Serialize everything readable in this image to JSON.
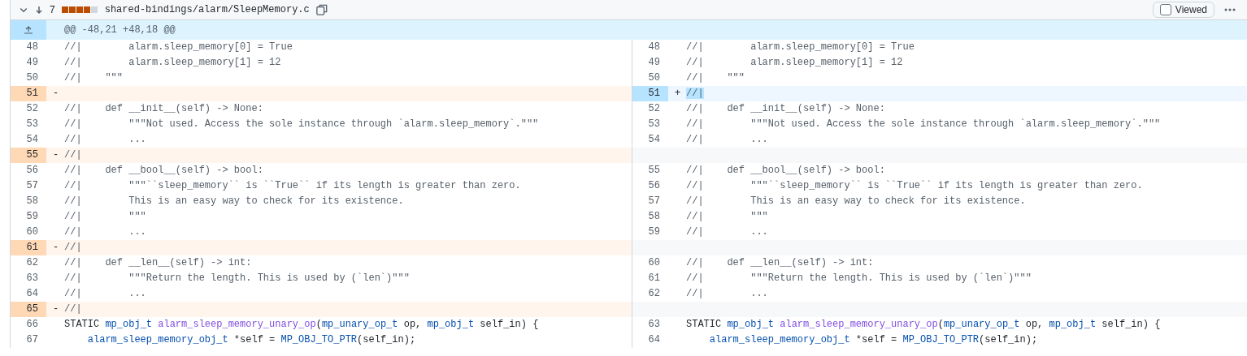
{
  "file_header": {
    "change_count": "7",
    "stat_blocks": [
      {
        "kind": "deleted"
      },
      {
        "kind": "deleted"
      },
      {
        "kind": "deleted"
      },
      {
        "kind": "deleted"
      },
      {
        "kind": "neutral"
      }
    ],
    "path": "shared-bindings/alarm/SleepMemory.c",
    "viewed": {
      "label": "Viewed",
      "checked": false
    }
  },
  "hunk": {
    "header": "@@ -48,21 +48,18 @@"
  },
  "rows": [
    {
      "left": {
        "kind": "context",
        "num": "48",
        "code": [
          {
            "kind": "comment",
            "text": "//|        alarm.sleep_memory[0] = True"
          }
        ]
      },
      "right": {
        "kind": "context",
        "num": "48",
        "code": [
          {
            "kind": "comment",
            "text": "//|        alarm.sleep_memory[0] = True"
          }
        ]
      }
    },
    {
      "left": {
        "kind": "context",
        "num": "49",
        "code": [
          {
            "kind": "comment",
            "text": "//|        alarm.sleep_memory[1] = 12"
          }
        ]
      },
      "right": {
        "kind": "context",
        "num": "49",
        "code": [
          {
            "kind": "comment",
            "text": "//|        alarm.sleep_memory[1] = 12"
          }
        ]
      }
    },
    {
      "left": {
        "kind": "context",
        "num": "50",
        "code": [
          {
            "kind": "comment",
            "text": "//|    \"\"\""
          }
        ]
      },
      "right": {
        "kind": "context",
        "num": "50",
        "code": [
          {
            "kind": "comment",
            "text": "//|    \"\"\""
          }
        ]
      }
    },
    {
      "left": {
        "kind": "deleted",
        "num": "51",
        "sign": "-"
      },
      "right": {
        "kind": "added",
        "num": "51",
        "sign": "+",
        "code": [
          {
            "kind": "highlight",
            "text": "//|"
          }
        ]
      }
    },
    {
      "left": {
        "kind": "context",
        "num": "52",
        "code": [
          {
            "kind": "comment",
            "text": "//|    def __init__(self) -> None:"
          }
        ]
      },
      "right": {
        "kind": "context",
        "num": "52",
        "code": [
          {
            "kind": "comment",
            "text": "//|    def __init__(self) -> None:"
          }
        ]
      }
    },
    {
      "left": {
        "kind": "context",
        "num": "53",
        "code": [
          {
            "kind": "comment",
            "text": "//|        \"\"\"Not used. Access the sole instance through `alarm.sleep_memory`.\"\"\""
          }
        ]
      },
      "right": {
        "kind": "context",
        "num": "53",
        "code": [
          {
            "kind": "comment",
            "text": "//|        \"\"\"Not used. Access the sole instance through `alarm.sleep_memory`.\"\"\""
          }
        ]
      }
    },
    {
      "left": {
        "kind": "context",
        "num": "54",
        "code": [
          {
            "kind": "comment",
            "text": "//|        ..."
          }
        ]
      },
      "right": {
        "kind": "context",
        "num": "54",
        "code": [
          {
            "kind": "comment",
            "text": "//|        ..."
          }
        ]
      }
    },
    {
      "left": {
        "kind": "deleted",
        "num": "55",
        "sign": "-",
        "code": [
          {
            "kind": "comment",
            "text": "//|"
          }
        ]
      },
      "right": {
        "kind": "empty"
      }
    },
    {
      "left": {
        "kind": "context",
        "num": "56",
        "code": [
          {
            "kind": "comment",
            "text": "//|    def __bool__(self) -> bool:"
          }
        ]
      },
      "right": {
        "kind": "context",
        "num": "55",
        "code": [
          {
            "kind": "comment",
            "text": "//|    def __bool__(self) -> bool:"
          }
        ]
      }
    },
    {
      "left": {
        "kind": "context",
        "num": "57",
        "code": [
          {
            "kind": "comment",
            "text": "//|        \"\"\"``sleep_memory`` is ``True`` if its length is greater than zero."
          }
        ]
      },
      "right": {
        "kind": "context",
        "num": "56",
        "code": [
          {
            "kind": "comment",
            "text": "//|        \"\"\"``sleep_memory`` is ``True`` if its length is greater than zero."
          }
        ]
      }
    },
    {
      "left": {
        "kind": "context",
        "num": "58",
        "code": [
          {
            "kind": "comment",
            "text": "//|        This is an easy way to check for its existence."
          }
        ]
      },
      "right": {
        "kind": "context",
        "num": "57",
        "code": [
          {
            "kind": "comment",
            "text": "//|        This is an easy way to check for its existence."
          }
        ]
      }
    },
    {
      "left": {
        "kind": "context",
        "num": "59",
        "code": [
          {
            "kind": "comment",
            "text": "//|        \"\"\""
          }
        ]
      },
      "right": {
        "kind": "context",
        "num": "58",
        "code": [
          {
            "kind": "comment",
            "text": "//|        \"\"\""
          }
        ]
      }
    },
    {
      "left": {
        "kind": "context",
        "num": "60",
        "code": [
          {
            "kind": "comment",
            "text": "//|        ..."
          }
        ]
      },
      "right": {
        "kind": "context",
        "num": "59",
        "code": [
          {
            "kind": "comment",
            "text": "//|        ..."
          }
        ]
      }
    },
    {
      "left": {
        "kind": "deleted",
        "num": "61",
        "sign": "-",
        "code": [
          {
            "kind": "comment",
            "text": "//|"
          }
        ]
      },
      "right": {
        "kind": "empty"
      }
    },
    {
      "left": {
        "kind": "context",
        "num": "62",
        "code": [
          {
            "kind": "comment",
            "text": "//|    def __len__(self) -> int:"
          }
        ]
      },
      "right": {
        "kind": "context",
        "num": "60",
        "code": [
          {
            "kind": "comment",
            "text": "//|    def __len__(self) -> int:"
          }
        ]
      }
    },
    {
      "left": {
        "kind": "context",
        "num": "63",
        "code": [
          {
            "kind": "comment",
            "text": "//|        \"\"\"Return the length. This is used by (`len`)\"\"\""
          }
        ]
      },
      "right": {
        "kind": "context",
        "num": "61",
        "code": [
          {
            "kind": "comment",
            "text": "//|        \"\"\"Return the length. This is used by (`len`)\"\"\""
          }
        ]
      }
    },
    {
      "left": {
        "kind": "context",
        "num": "64",
        "code": [
          {
            "kind": "comment",
            "text": "//|        ..."
          }
        ]
      },
      "right": {
        "kind": "context",
        "num": "62",
        "code": [
          {
            "kind": "comment",
            "text": "//|        ..."
          }
        ]
      }
    },
    {
      "left": {
        "kind": "deleted",
        "num": "65",
        "sign": "-",
        "code": [
          {
            "kind": "comment",
            "text": "//|"
          }
        ]
      },
      "right": {
        "kind": "empty"
      }
    },
    {
      "left": {
        "kind": "context",
        "num": "66",
        "code": [
          {
            "kind": "plain",
            "text": "STATIC "
          },
          {
            "kind": "type",
            "text": "mp_obj_t"
          },
          {
            "kind": "func",
            "text": " alarm_sleep_memory_unary_op"
          },
          {
            "kind": "plain",
            "text": "("
          },
          {
            "kind": "type",
            "text": "mp_unary_op_t"
          },
          {
            "kind": "plain",
            "text": " op, "
          },
          {
            "kind": "type",
            "text": "mp_obj_t"
          },
          {
            "kind": "plain",
            "text": " self_in) {"
          }
        ]
      },
      "right": {
        "kind": "context",
        "num": "63",
        "code": [
          {
            "kind": "plain",
            "text": "STATIC "
          },
          {
            "kind": "type",
            "text": "mp_obj_t"
          },
          {
            "kind": "func",
            "text": " alarm_sleep_memory_unary_op"
          },
          {
            "kind": "plain",
            "text": "("
          },
          {
            "kind": "type",
            "text": "mp_unary_op_t"
          },
          {
            "kind": "plain",
            "text": " op, "
          },
          {
            "kind": "type",
            "text": "mp_obj_t"
          },
          {
            "kind": "plain",
            "text": " self_in) {"
          }
        ]
      }
    },
    {
      "left": {
        "kind": "context",
        "num": "67",
        "code": [
          {
            "kind": "type",
            "text": "    alarm_sleep_memory_obj_t"
          },
          {
            "kind": "plain",
            "text": " *self = "
          },
          {
            "kind": "type",
            "text": "MP_OBJ_TO_PTR"
          },
          {
            "kind": "plain",
            "text": "(self_in);"
          }
        ]
      },
      "right": {
        "kind": "context",
        "num": "64",
        "code": [
          {
            "kind": "type",
            "text": "    alarm_sleep_memory_obj_t"
          },
          {
            "kind": "plain",
            "text": " *self = "
          },
          {
            "kind": "type",
            "text": "MP_OBJ_TO_PTR"
          },
          {
            "kind": "plain",
            "text": "(self_in);"
          }
        ]
      }
    }
  ]
}
